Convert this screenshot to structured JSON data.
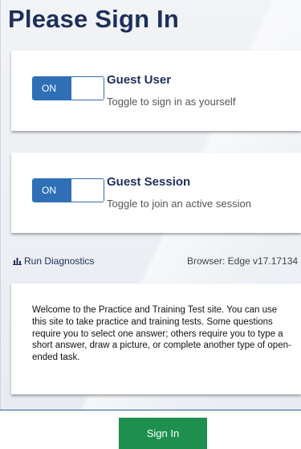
{
  "header": {
    "title": "Please Sign In"
  },
  "guest_user": {
    "toggle_label": "ON",
    "title": "Guest User",
    "subtitle": "Toggle to sign in as yourself"
  },
  "guest_session": {
    "toggle_label": "ON",
    "title": "Guest Session",
    "subtitle": "Toggle to join an active session"
  },
  "diagnostics": {
    "label": "Run Diagnostics",
    "icon": "bar-chart-icon"
  },
  "browser_info": "Browser: Edge v17.17134",
  "welcome_text": "Welcome to the Practice and Training Test site. You can use this site to take practice and training tests. Some questions require you to select one answer; others require you to type a short answer, draw a picture, or complete another type of open-ended task.",
  "footer": {
    "sign_in_label": "Sign In"
  },
  "colors": {
    "accent": "#2f6fb6",
    "title": "#1e2f5a",
    "sign_in": "#1e8f4e"
  }
}
